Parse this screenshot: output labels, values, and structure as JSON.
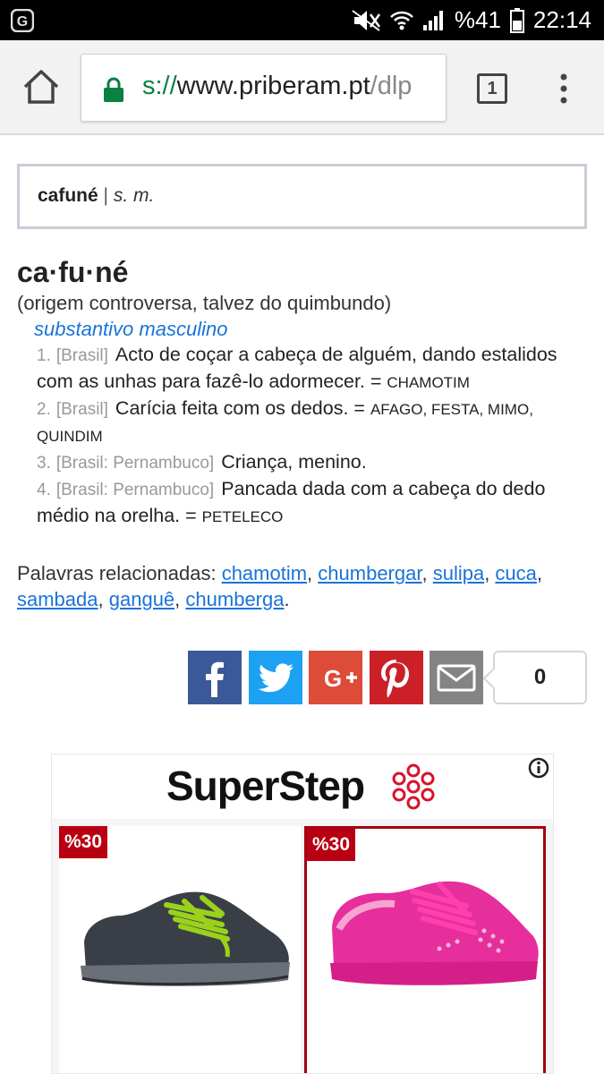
{
  "status_bar": {
    "battery_text": "%41",
    "time": "22:14"
  },
  "browser": {
    "url_scheme": "s://",
    "url_host": "www.priberam.pt",
    "url_path": "/dlp",
    "tab_count": "1"
  },
  "search": {
    "word": "cafuné",
    "separator": " | ",
    "gram": "s. m."
  },
  "entry": {
    "headword": "ca·fu·né",
    "etymology": "(origem controversa, talvez do quimbundo)",
    "part_of_speech": "substantivo masculino",
    "senses": [
      {
        "num": "1.",
        "region": "[Brasil]",
        "text": "Acto de coçar a cabeça de alguém, dando estalidos com as unhas para fazê-lo adormecer. = ",
        "synonyms": "CHAMOTIM"
      },
      {
        "num": "2.",
        "region": "[Brasil]",
        "text": "Carícia feita com os dedos. = ",
        "synonyms": "AFAGO, FESTA, MIMO, QUINDIM"
      },
      {
        "num": "3.",
        "region": "[Brasil: Pernambuco]",
        "text": "Criança, menino.",
        "synonyms": ""
      },
      {
        "num": "4.",
        "region": "[Brasil: Pernambuco]",
        "text": "Pancada dada com a cabeça do dedo médio na orelha. = ",
        "synonyms": "PETELECO"
      }
    ]
  },
  "related": {
    "label": "Palavras relacionadas: ",
    "words": [
      "chamotim",
      "chumbergar",
      "sulipa",
      "cuca",
      "sambada",
      "ganguê",
      "chumberga"
    ]
  },
  "share": {
    "count": "0",
    "colors": {
      "facebook": "#3b5998",
      "twitter": "#1da1f2",
      "google": "#dd4b39",
      "pinterest": "#cb2027",
      "email": "#848484"
    }
  },
  "ad": {
    "brand": "SuperStep",
    "products": [
      {
        "badge": "%30",
        "color": "#3a3f47"
      },
      {
        "badge": "%30",
        "color": "#e62f9c"
      }
    ]
  }
}
